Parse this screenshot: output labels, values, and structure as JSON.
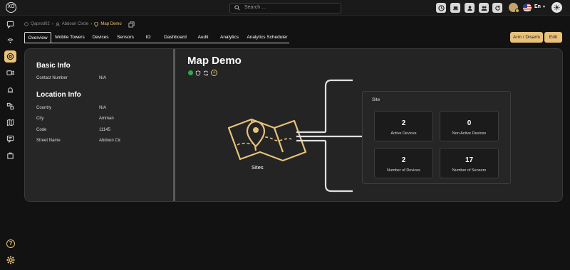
{
  "header": {
    "logo_text": "XO",
    "search_placeholder": "Search ...",
    "language": "En",
    "icons": [
      "clock-icon",
      "laptop-icon",
      "user-icon",
      "user-group-icon",
      "refresh-icon"
    ]
  },
  "sidebar": {
    "items": [
      "chat-icon",
      "radar-icon",
      "gauge-icon",
      "camera-icon",
      "alarm-icon",
      "device-icon",
      "map-icon",
      "message-icon",
      "bag-icon"
    ],
    "active_index": 2,
    "help_icon": "?"
  },
  "breadcrumb": {
    "items": [
      "Qaprod02",
      "Abdoun Circle"
    ],
    "current": "Map Demo"
  },
  "tabs": [
    "Overview",
    "Mobile Towers",
    "Devices",
    "Sensors",
    "IO",
    "Dashboard",
    "Audit",
    "Analytics",
    "Analytics Scheduler"
  ],
  "active_tab": "Overview",
  "actions": {
    "arm_disarm": "Arm / Disarm",
    "edit": "Edit"
  },
  "basic_info": {
    "title": "Basic Info",
    "rows": [
      {
        "label": "Contact Number",
        "value": "N/A"
      }
    ]
  },
  "location_info": {
    "title": "Location Info",
    "rows": [
      {
        "label": "Country",
        "value": "N/A"
      },
      {
        "label": "City",
        "value": "Amman"
      },
      {
        "label": "Code",
        "value": "11145"
      },
      {
        "label": "Street Name",
        "value": "Abdoun Cir."
      }
    ]
  },
  "main": {
    "title": "Map Demo",
    "status_color": "#2fa84f",
    "sites_label": "Sites"
  },
  "site": {
    "title": "Site",
    "stats": [
      {
        "value": "2",
        "label": "Active Devices"
      },
      {
        "value": "0",
        "label": "Non Active Devices"
      },
      {
        "value": "2",
        "label": "Number of Devices"
      },
      {
        "value": "17",
        "label": "Number of Sensors"
      }
    ]
  },
  "colors": {
    "accent": "#e8c27a",
    "background": "#121212",
    "panel": "#242424"
  }
}
